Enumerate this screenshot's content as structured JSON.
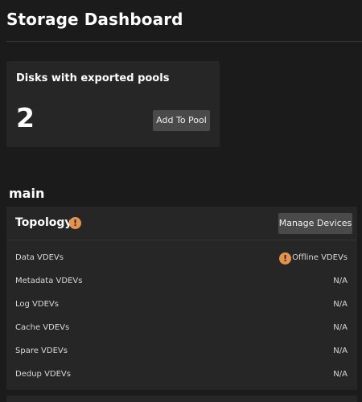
{
  "header": {
    "title": "Storage Dashboard"
  },
  "exported_card": {
    "title": "Disks with exported pools",
    "count": "2",
    "button_label": "Add To Pool"
  },
  "pool": {
    "name": "main",
    "topology": {
      "title": "Topology",
      "warning_icon": "warning-icon",
      "button_label": "Manage Devices",
      "rows": [
        {
          "label": "Data VDEVs",
          "value": "Offline VDEVs",
          "warning": true
        },
        {
          "label": "Metadata VDEVs",
          "value": "N/A"
        },
        {
          "label": "Log VDEVs",
          "value": "N/A"
        },
        {
          "label": "Cache VDEVs",
          "value": "N/A"
        },
        {
          "label": "Spare VDEVs",
          "value": "N/A"
        },
        {
          "label": "Dedup VDEVs",
          "value": "N/A"
        }
      ]
    }
  },
  "colors": {
    "background": "#1b1b1b",
    "card": "#262626",
    "button": "#4a4a4a",
    "warning": "#e5934b"
  }
}
